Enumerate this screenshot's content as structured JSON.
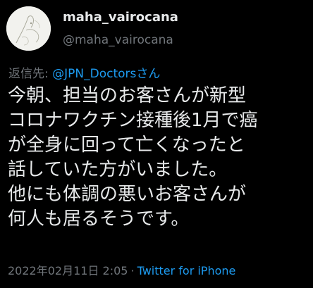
{
  "colors": {
    "background": "#000000",
    "text": "#e7e9ea",
    "secondary": "#71767b",
    "accent": "#1d9bf0"
  },
  "author": {
    "display_name": "maha_vairocana",
    "handle": "@maha_vairocana",
    "avatar_icon": "line-drawing-avatar"
  },
  "reply": {
    "prefix": "返信先: ",
    "mention": "@JPN_Doctors",
    "suffix": "さん"
  },
  "tweet": {
    "lines": [
      "今朝、担当のお客さんが新型",
      "コロナワクチン接種後1月で癌",
      "が全身に回って亡くなったと",
      "話していた方がいました。",
      "他にも体調の悪いお客さんが",
      "何人も居るそうです。"
    ]
  },
  "meta": {
    "timestamp": "2022年02月11日 2:05",
    "separator": "·",
    "source": "Twitter for iPhone"
  }
}
